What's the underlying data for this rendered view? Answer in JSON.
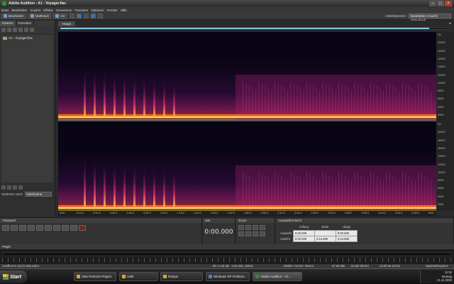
{
  "window": {
    "title": "Adobe Audition - A1 - Voyager.flac"
  },
  "menu": [
    "Datei",
    "Bearbeiten",
    "Ansicht",
    "Effekte",
    "Generieren",
    "Favoriten",
    "Optionen",
    "Fenster",
    "Hilfe"
  ],
  "toolbar": {
    "edit_label": "Bearbeiten",
    "multitrack_label": "Multitrack",
    "cd_label": "CD",
    "workspace_label": "Arbeitsbereich:",
    "workspace_value": "Bearbeiten-Ansicht (Standard)"
  },
  "left_panel": {
    "tabs": [
      "Dateien",
      "Favoriten"
    ],
    "files": [
      "A1 - Voyager.flac"
    ],
    "sort_label": "Sortieren nach:",
    "sort_value": "Dateiname"
  },
  "editor": {
    "tab": "Haupt",
    "y_ticks": [
      "Hz",
      "20000",
      "18000",
      "16000",
      "14000",
      "12000",
      "10000",
      "8000",
      "6000",
      "4000",
      "2000",
      "Hz",
      "20000",
      "18000",
      "16000",
      "14000",
      "12000",
      "10000",
      "8000",
      "6000",
      "4000",
      "2000"
    ],
    "x_ticks": [
      "hms",
      "0:10.0",
      "0:20.0",
      "0:30.0",
      "0:40.0",
      "0:50.0",
      "1:00.0",
      "1:10.0",
      "1:20.0",
      "1:30.0",
      "1:40.0",
      "1:50.0",
      "2:00.0",
      "2:10.0",
      "2:20.0",
      "2:30.0",
      "2:40.0",
      "2:50.0",
      "3:00.0",
      "3:10.0",
      "3:20.0",
      "3:30.0",
      "hms"
    ]
  },
  "transport": {
    "title": "Transport"
  },
  "zeit": {
    "title": "Zeit",
    "value": "0:00.000"
  },
  "zoom": {
    "title": "Zoom"
  },
  "selection": {
    "title": "Auswahl/Ansicht",
    "headers": [
      "Anfang",
      "Ende",
      "Länge"
    ],
    "rows": [
      {
        "label": "Auswahl",
        "values": [
          "0:00.000",
          "",
          "0:00.000"
        ]
      },
      {
        "label": "Ansicht",
        "values": [
          "0:00.000",
          "2:13.690",
          "2:13.690"
        ]
      }
    ]
  },
  "levels": {
    "title": "Pegel"
  },
  "status": {
    "left": "Geöffnet in 16,10 Sekunden",
    "format": "96 / 0.48 dB · 1:00.025, 250Hz",
    "sample": "96000 • 32-bit • Stereo",
    "size": "97,90 MB",
    "disk": "64,88 GB frei",
    "time": "23:00:26.23 frei",
    "view": "Spektralfrequenz"
  },
  "taskbar": {
    "start": "Start",
    "items": [
      "Alan Parsons Project",
      "USB",
      "Ranjan",
      "Windows XP Professi...",
      "Adobe Audition - A1..."
    ],
    "clock": "11:52",
    "day": "Montag",
    "date": "21.12.2009"
  },
  "spectrogram_colors": [
    "#0a0514",
    "#2a0a3e",
    "#6a1a6e",
    "#b8237a",
    "#f0522a",
    "#ffd54a"
  ]
}
